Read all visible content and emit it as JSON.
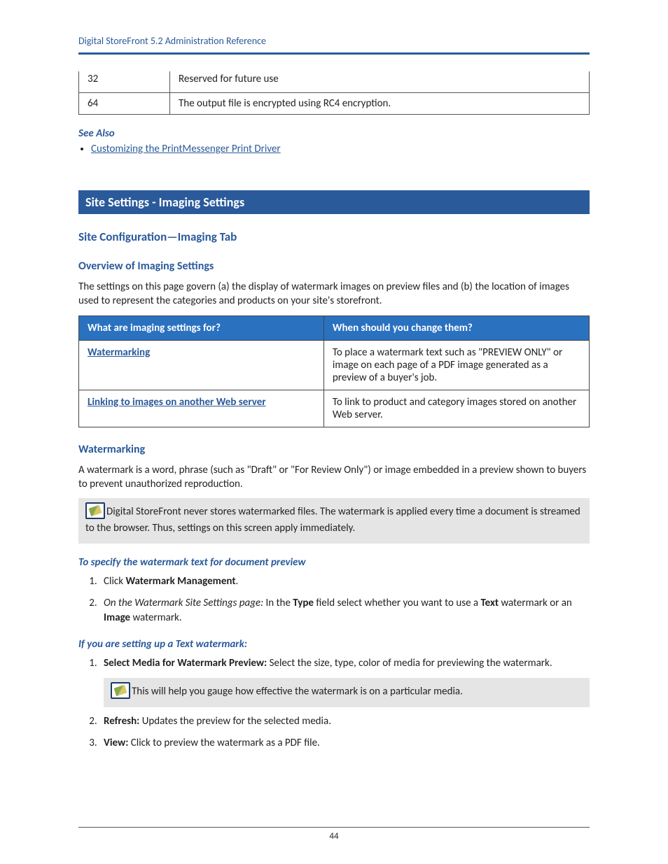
{
  "headerTitle": "Digital StoreFront 5.2 Administration Reference",
  "table1": {
    "row1": {
      "c1": "32",
      "c2": "Reserved for future use"
    },
    "row2": {
      "c1": "64",
      "c2": "The output file is encrypted using RC4 encryption."
    }
  },
  "seeAlso": "See Also",
  "seeAlsoLink": "Customizing the PrintMessenger Print Driver",
  "sectionBanner": "Site Settings - Imaging Settings",
  "h2a": "Site Configuration—Imaging Tab",
  "h3a": "Overview of Imaging Settings",
  "overviewText": "The settings on this page govern (a) the display of watermark images on preview files and (b) the location of images used to represent the categories and products on your site's storefront.",
  "table2": {
    "th1": "What are imaging settings for?",
    "th2": "When should you change them?",
    "r1c1": "Watermarking",
    "r1c2": "To place a watermark text such as \"PREVIEW ONLY\" or image on each page of a PDF image generated as a preview of a buyer's job.",
    "r2c1": "Linking to images on another Web server",
    "r2c2": "To link to product and category images stored on another Web server."
  },
  "h3b": "Watermarking",
  "watermarkPara": "A watermark is a word, phrase (such as \"Draft\" or \"For Review Only\") or image embedded in a preview shown to buyers to prevent unauthorized reproduction.",
  "note1": "Digital StoreFront never stores watermarked files. The watermark is applied every time a document is streamed to the browser. Thus, settings on this screen apply immediately.",
  "procHeading1": "To specify the watermark text for document preview",
  "step1_pre": "Click ",
  "step1_bold": "Watermark Management",
  "step1_post": ".",
  "step2_it": "On the Watermark Site Settings page:",
  "step2_mid": " In the ",
  "step2_b1": "Type",
  "step2_mid2": " field select whether you want to use a ",
  "step2_b2": "Text",
  "step2_mid3": " watermark or an ",
  "step2_b3": "Image",
  "step2_end": " watermark.",
  "procHeading2": "If you are setting up a Text watermark:",
  "tstep1_b": "Select Media for Watermark Preview:",
  "tstep1_r": " Select the size, type, color of media for previewing the watermark.",
  "note2": "This will help you gauge how effective the watermark is on a particular media.",
  "tstep2_b": "Refresh:",
  "tstep2_r": " Updates the preview for the selected media.",
  "tstep3_b": "View:",
  "tstep3_r": " Click to preview the watermark as a PDF file.",
  "pageNumber": "44"
}
